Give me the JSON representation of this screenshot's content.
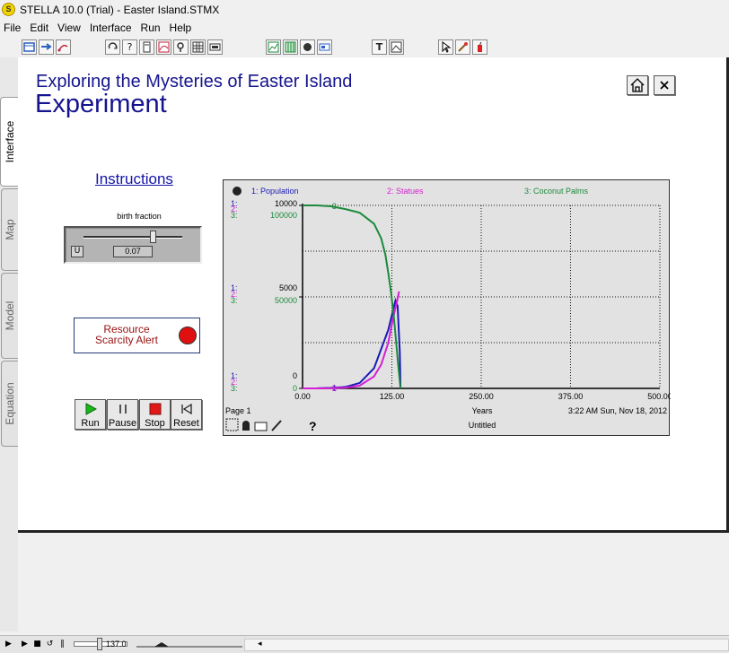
{
  "window": {
    "title": "STELLA 10.0 (Trial) - Easter Island.STMX",
    "app_icon_letter": "S"
  },
  "menu": [
    "File",
    "Edit",
    "View",
    "Interface",
    "Run",
    "Help"
  ],
  "tabs": [
    "Interface",
    "Map",
    "Model",
    "Equation"
  ],
  "active_tab": "Interface",
  "page": {
    "title": "Exploring the Mysteries of Easter Island",
    "subtitle": "Experiment",
    "instructions_link": "Instructions"
  },
  "slider": {
    "label": "birth fraction",
    "value": "0.07",
    "lock_label": "U",
    "min": 0,
    "max": 0.1,
    "position": 0.7
  },
  "alert": {
    "label": "Resource Scarcity Alert",
    "line1": "Resource",
    "line2": "Scarcity Alert",
    "lamp_color": "#e01010"
  },
  "controls": [
    {
      "id": "run",
      "label": "Run",
      "icon": "play-icon"
    },
    {
      "id": "pause",
      "label": "Pause",
      "icon": "pause-icon"
    },
    {
      "id": "stop",
      "label": "Stop",
      "icon": "stop-icon"
    },
    {
      "id": "reset",
      "label": "Reset",
      "icon": "reset-icon"
    }
  ],
  "graph": {
    "page_label": "Page 1",
    "x_label": "Years",
    "timestamp": "3:22 AM  Sun, Nov 18, 2012",
    "untitled": "Untitled",
    "help_mark": "?"
  },
  "status": {
    "time_value": "137.0",
    "speed_fraction": 0.55
  },
  "chart_data": {
    "type": "line",
    "x_label": "Years",
    "x_ticks": [
      "0.00",
      "125.00",
      "250.00",
      "375.00",
      "500.00"
    ],
    "xlim": [
      0,
      500
    ],
    "grid": true,
    "series": [
      {
        "name": "1: Population",
        "color": "#1a1ab8",
        "axis_ticks": [
          "10000",
          "5000",
          "0"
        ],
        "ylim": [
          0,
          10000
        ],
        "x": [
          0,
          20,
          40,
          60,
          80,
          100,
          120,
          130,
          133,
          136,
          137
        ],
        "values": [
          0,
          5,
          30,
          80,
          300,
          1100,
          3200,
          4800,
          4500,
          2000,
          0
        ]
      },
      {
        "name": "2: Statues",
        "color": "#d61ed6",
        "axis_ticks": [
          "",
          "",
          ""
        ],
        "ylim": [
          0,
          10000
        ],
        "x": [
          0,
          20,
          40,
          60,
          80,
          100,
          110,
          120,
          126,
          130,
          133,
          135
        ],
        "values": [
          0,
          0,
          10,
          40,
          150,
          650,
          1300,
          2500,
          3700,
          4400,
          4900,
          5300
        ]
      },
      {
        "name": "3: Coconut Palms",
        "color": "#1c8a3c",
        "axis_ticks": [
          "100000",
          "50000",
          "0"
        ],
        "ylim": [
          0,
          100000
        ],
        "x": [
          0,
          20,
          40,
          60,
          80,
          100,
          110,
          116,
          120,
          124,
          128,
          131,
          134,
          137
        ],
        "values": [
          100000,
          100000,
          99500,
          98000,
          96000,
          90000,
          82000,
          73000,
          63000,
          52000,
          38000,
          25000,
          12000,
          0
        ]
      }
    ]
  }
}
